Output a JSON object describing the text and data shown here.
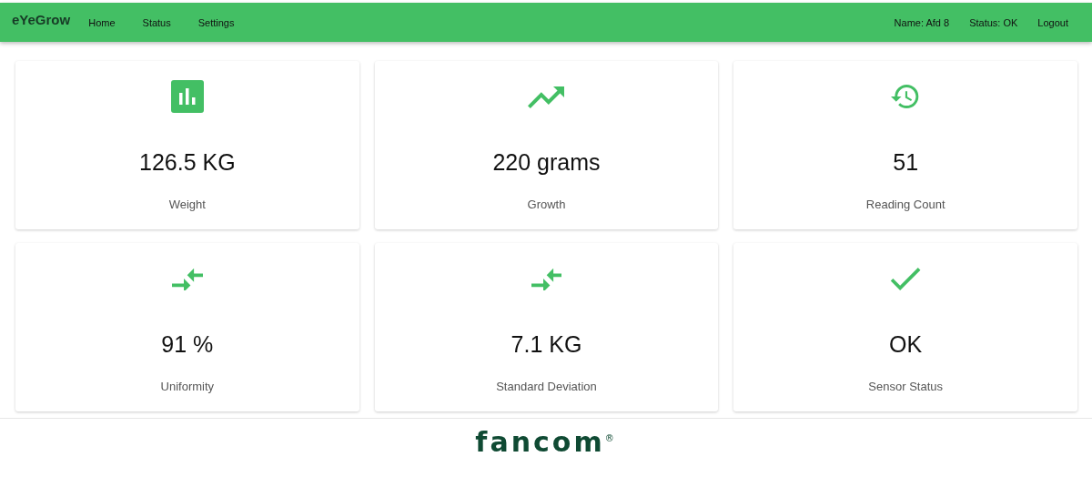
{
  "navbar": {
    "brand": "eYeGrow",
    "links": [
      "Home",
      "Status",
      "Settings"
    ],
    "user": "Name: Afd 8",
    "status": "Status: OK",
    "logout": "Logout"
  },
  "cards": [
    {
      "kind": "bar-chart",
      "value": "126.5 KG",
      "label": "Weight"
    },
    {
      "kind": "trending-up",
      "value": "220 grams",
      "label": "Growth"
    },
    {
      "kind": "history",
      "value": "51",
      "label": "Reading Count"
    },
    {
      "kind": "compare-arrows",
      "value": "91 %",
      "label": "Uniformity"
    },
    {
      "kind": "compare-arrows",
      "value": "7.1 KG",
      "label": "Standard Deviation"
    },
    {
      "kind": "check",
      "value": "OK",
      "label": "Sensor Status"
    }
  ],
  "footer": {
    "logo": "fancom$^{®}$"
  }
}
